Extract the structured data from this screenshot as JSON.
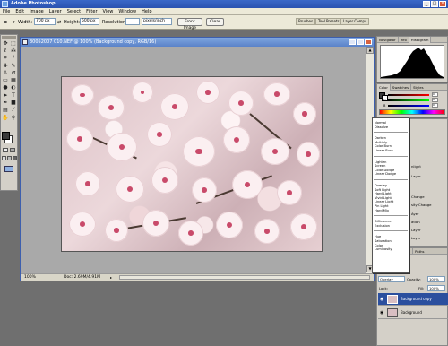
{
  "app": {
    "title": "Adobe Photoshop",
    "accent": "#2a52b0"
  },
  "window_controls": {
    "minimize": "_",
    "maximize": "□",
    "close": "x"
  },
  "menu": [
    "File",
    "Edit",
    "Image",
    "Layer",
    "Select",
    "Filter",
    "View",
    "Window",
    "Help"
  ],
  "options_bar": {
    "width_label": "Width:",
    "width_value": "700 px",
    "height_label": "Height:",
    "height_value": "500 px",
    "resolution_label": "Resolution:",
    "resolution_unit": "pixels/inch",
    "front_image_button": "Front Image",
    "clear_button": "Clear",
    "palette_tabs": [
      "Brushes",
      "Tool Presets",
      "Layer Comps"
    ]
  },
  "toolbox": {
    "tools": [
      "move-icon",
      "marquee-icon",
      "lasso-icon",
      "magic-wand-icon",
      "crop-icon",
      "slice-icon",
      "healing-icon",
      "brush-icon",
      "stamp-icon",
      "history-brush-icon",
      "eraser-icon",
      "gradient-icon",
      "blur-icon",
      "dodge-icon",
      "path-select-icon",
      "type-icon",
      "pen-icon",
      "shape-icon",
      "notes-icon",
      "eyedropper-icon",
      "hand-icon",
      "zoom-icon"
    ],
    "foreground_color": "#3a3a3a",
    "background_color": "#ffffff"
  },
  "document": {
    "title": "30052007 010.NEF @ 100% (Background copy, RGB/16)",
    "zoom": "100%",
    "status": "Doc: 2.69M/4.91M"
  },
  "navigator_panel": {
    "tabs": [
      "Navigator",
      "Info",
      "Histogram"
    ],
    "active_tab": "Histogram"
  },
  "color_panel": {
    "tabs": [
      "Color",
      "Swatches",
      "Styles"
    ],
    "sliders": [
      {
        "label": "R",
        "value": "0",
        "color": "#cc3333"
      },
      {
        "label": "G",
        "value": "0",
        "color": "#33aa33"
      },
      {
        "label": "B",
        "value": "0",
        "color": "#3355cc"
      }
    ]
  },
  "blend_modes": {
    "groups": [
      [
        "Normal",
        "Dissolve"
      ],
      [
        "Darken",
        "Multiply",
        "Color Burn",
        "Linear Burn"
      ],
      [
        "Lighten",
        "Screen",
        "Color Dodge",
        "Linear Dodge"
      ],
      [
        "Overlay",
        "Soft Light",
        "Hard Light",
        "Vivid Light",
        "Linear Light",
        "Pin Light",
        "Hard Mix"
      ],
      [
        "Difference",
        "Exclusion"
      ],
      [
        "Hue",
        "Saturation",
        "Color",
        "Luminosity"
      ]
    ],
    "selected": "Overlay"
  },
  "styles_panel_fragments": [
    "nlight",
    "Layer",
    "Change",
    "sity Change",
    "Ayer",
    "ation",
    "Layer",
    "Layer"
  ],
  "layers_panel": {
    "tabs": [
      "Layers",
      "Channels",
      "Paths"
    ],
    "blend_mode": "Overlay",
    "opacity_label": "Opacity:",
    "opacity_value": "100%",
    "fill_label": "Fill:",
    "fill_value": "100%",
    "lock_label": "Lock:",
    "layers": [
      {
        "name": "Background copy",
        "selected": true
      },
      {
        "name": "Background",
        "selected": false
      }
    ]
  }
}
